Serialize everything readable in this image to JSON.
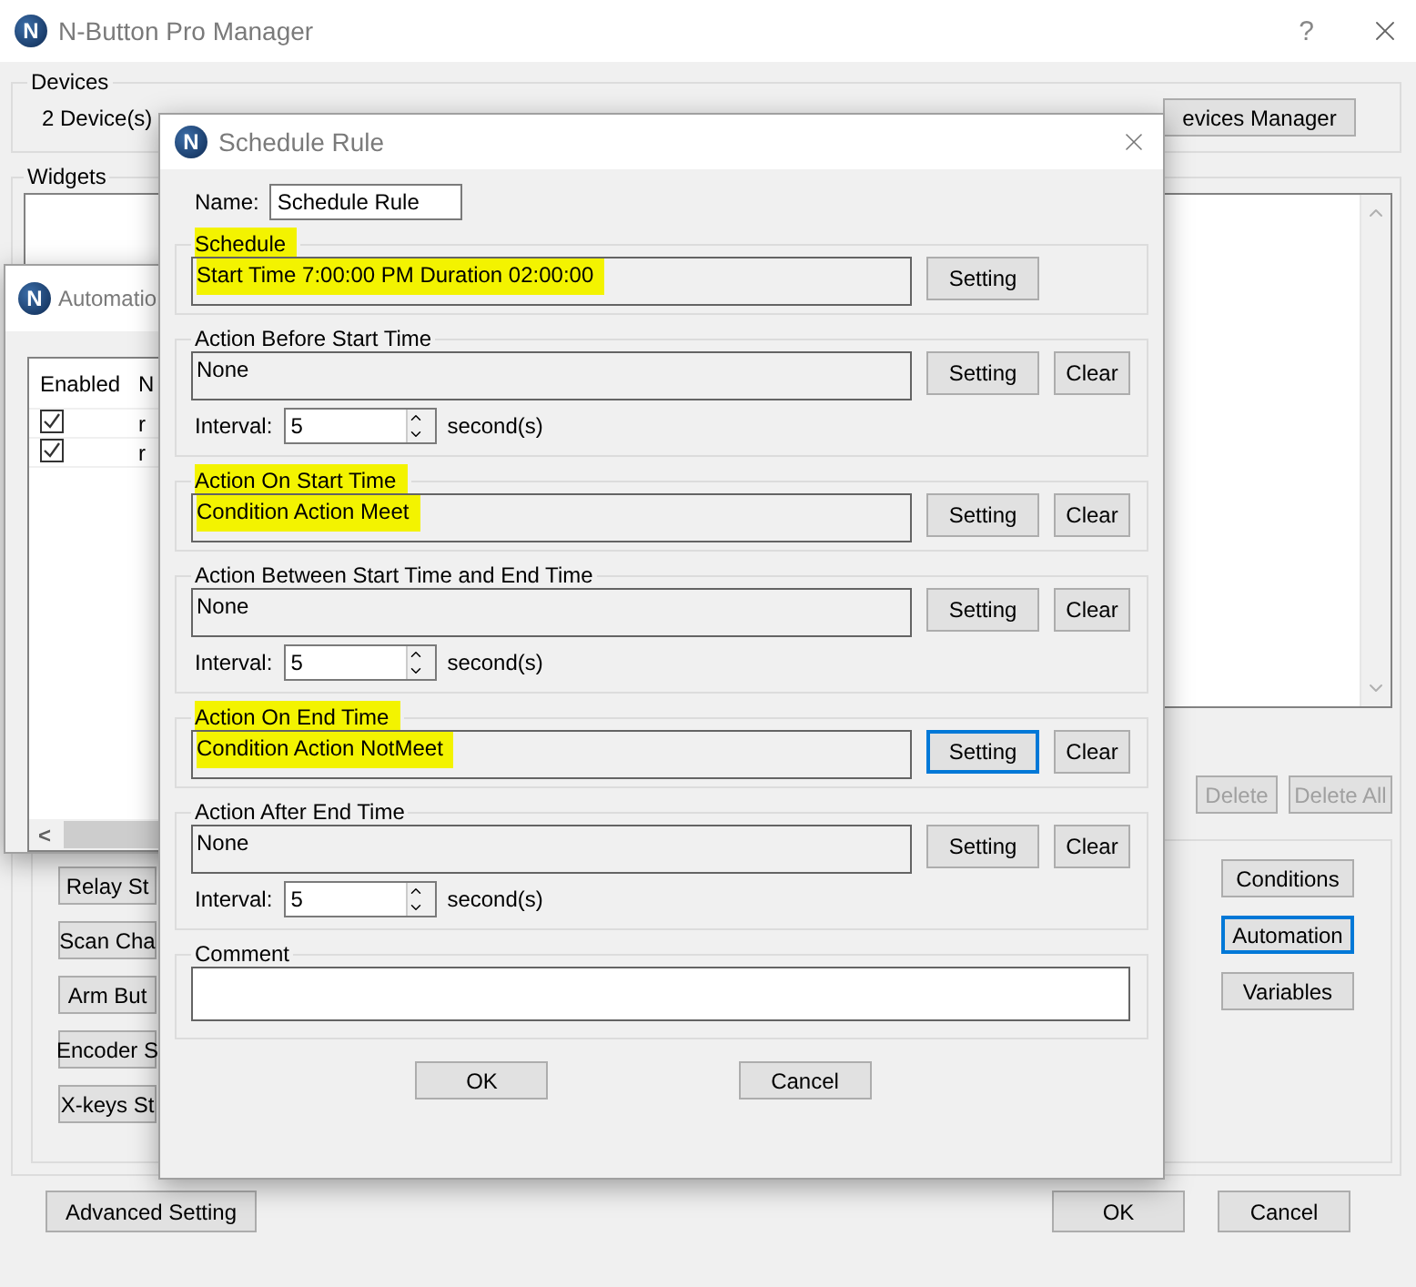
{
  "main_window": {
    "logo": "N",
    "title": "N-Button Pro Manager",
    "help": "?",
    "devices": {
      "legend": "Devices",
      "count": "2 Device(s)",
      "manager_button": "evices Manager"
    },
    "widgets": {
      "legend": "Widgets",
      "list_buttons": [
        "Delete",
        "Delete All"
      ],
      "left_buttons": [
        "Relay St",
        "Scan Cha",
        "Arm But",
        "Encoder S",
        "X-keys St"
      ],
      "right_buttons": [
        {
          "label": "Conditions",
          "focused": false
        },
        {
          "label": "Automation",
          "focused": true
        },
        {
          "label": "Variables",
          "focused": false
        }
      ]
    },
    "advanced_button": "Advanced Setting",
    "ok_button": "OK",
    "cancel_button": "Cancel"
  },
  "automation_window": {
    "logo": "N",
    "title": "Automatio",
    "columns": [
      "Enabled",
      "N"
    ],
    "rows": [
      {
        "enabled": true,
        "name": "r"
      },
      {
        "enabled": true,
        "name": "r"
      }
    ],
    "scroll_left": "<"
  },
  "schedule_dialog": {
    "logo": "N",
    "title": "Schedule Rule",
    "name_label": "Name:",
    "name_value": "Schedule Rule",
    "groups": [
      {
        "legend": "Schedule",
        "value": "Start Time 7:00:00 PM  Duration 02:00:00",
        "highlighted": true,
        "focused": false,
        "setting_label": "Setting"
      },
      {
        "legend": "Action Before Start Time",
        "value": "None",
        "highlighted": false,
        "focused": false,
        "setting_label": "Setting",
        "clear_label": "Clear",
        "interval_label": "Interval:",
        "interval": "5",
        "interval_unit": "second(s)"
      },
      {
        "legend": "Action On Start Time",
        "value": "Condition Action Meet",
        "highlighted": true,
        "focused": false,
        "setting_label": "Setting",
        "clear_label": "Clear"
      },
      {
        "legend": "Action Between Start Time and End Time",
        "value": "None",
        "highlighted": false,
        "focused": false,
        "setting_label": "Setting",
        "clear_label": "Clear",
        "interval_label": "Interval:",
        "interval": "5",
        "interval_unit": "second(s)"
      },
      {
        "legend": "Action On End Time",
        "value": "Condition Action NotMeet",
        "highlighted": true,
        "focused": true,
        "setting_label": "Setting",
        "clear_label": "Clear"
      },
      {
        "legend": "Action After End Time",
        "value": "None",
        "highlighted": false,
        "focused": false,
        "setting_label": "Setting",
        "clear_label": "Clear",
        "interval_label": "Interval:",
        "interval": "5",
        "interval_unit": "second(s)"
      }
    ],
    "comment_legend": "Comment",
    "ok_button": "OK",
    "cancel_button": "Cancel"
  }
}
